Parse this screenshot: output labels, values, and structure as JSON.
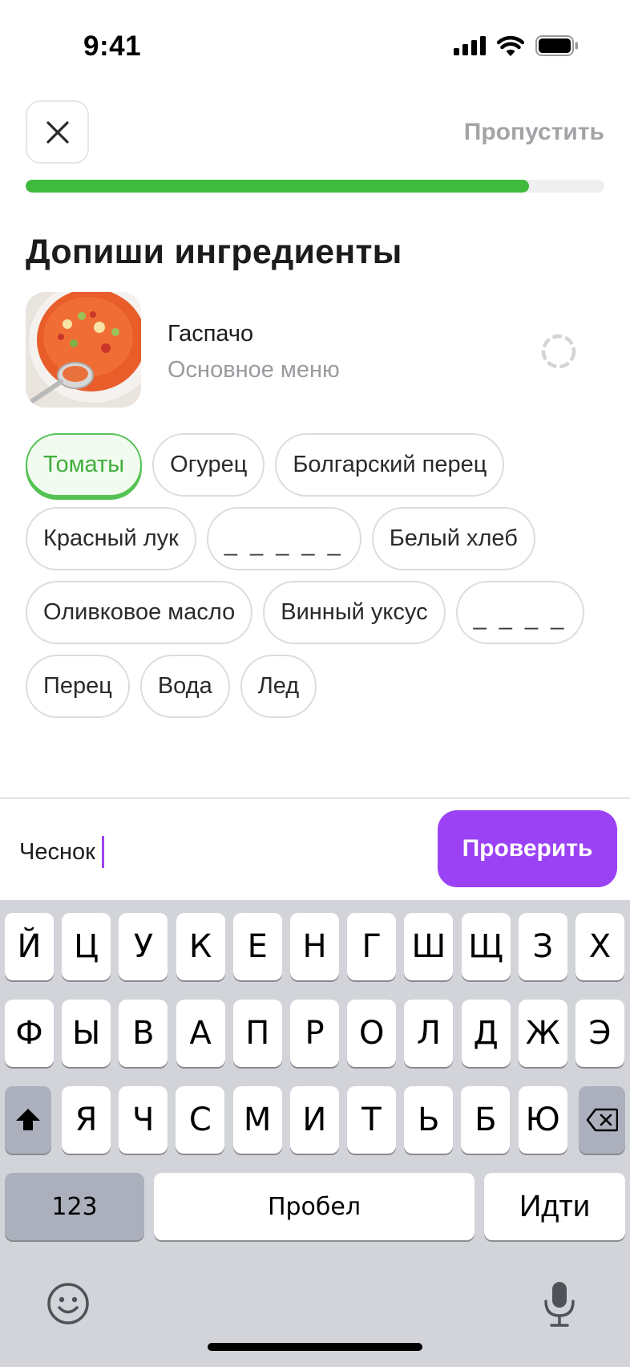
{
  "status_bar": {
    "time": "9:41"
  },
  "header": {
    "close_icon": "close-icon",
    "skip_label": "Пропустить",
    "progress": 0.87
  },
  "title": "Допиши ингредиенты",
  "dish": {
    "name": "Гаспачо",
    "category": "Основное меню"
  },
  "chips": [
    [
      {
        "label": "Томаты",
        "state": "correct"
      },
      {
        "label": "Огурец",
        "state": "normal"
      },
      {
        "label": "Болгарский перец",
        "state": "normal"
      }
    ],
    [
      {
        "label": "Красный лук",
        "state": "normal"
      },
      {
        "label": "_ _ _ _ _",
        "state": "blank"
      },
      {
        "label": "Белый хлеб",
        "state": "normal"
      }
    ],
    [
      {
        "label": "Оливковое масло",
        "state": "normal"
      },
      {
        "label": "Винный уксус",
        "state": "normal"
      },
      {
        "label": "_ _ _ _",
        "state": "blank"
      }
    ],
    [
      {
        "label": "Перец",
        "state": "normal"
      },
      {
        "label": "Вода",
        "state": "normal"
      },
      {
        "label": "Лед",
        "state": "normal"
      }
    ]
  ],
  "answer": {
    "value": "Чеснок"
  },
  "check_button": "Проверить",
  "keyboard": {
    "row1": [
      "Й",
      "Ц",
      "У",
      "К",
      "Е",
      "Н",
      "Г",
      "Ш",
      "Щ",
      "З",
      "Х"
    ],
    "row2": [
      "Ф",
      "Ы",
      "В",
      "А",
      "П",
      "Р",
      "О",
      "Л",
      "Д",
      "Ж",
      "Э"
    ],
    "row3": [
      "Я",
      "Ч",
      "С",
      "М",
      "И",
      "Т",
      "Ь",
      "Б",
      "Ю"
    ],
    "numbers": "123",
    "space": "Пробел",
    "go": "Идти"
  },
  "colors": {
    "accent": "#9b42f5",
    "success": "#3fba3d"
  }
}
